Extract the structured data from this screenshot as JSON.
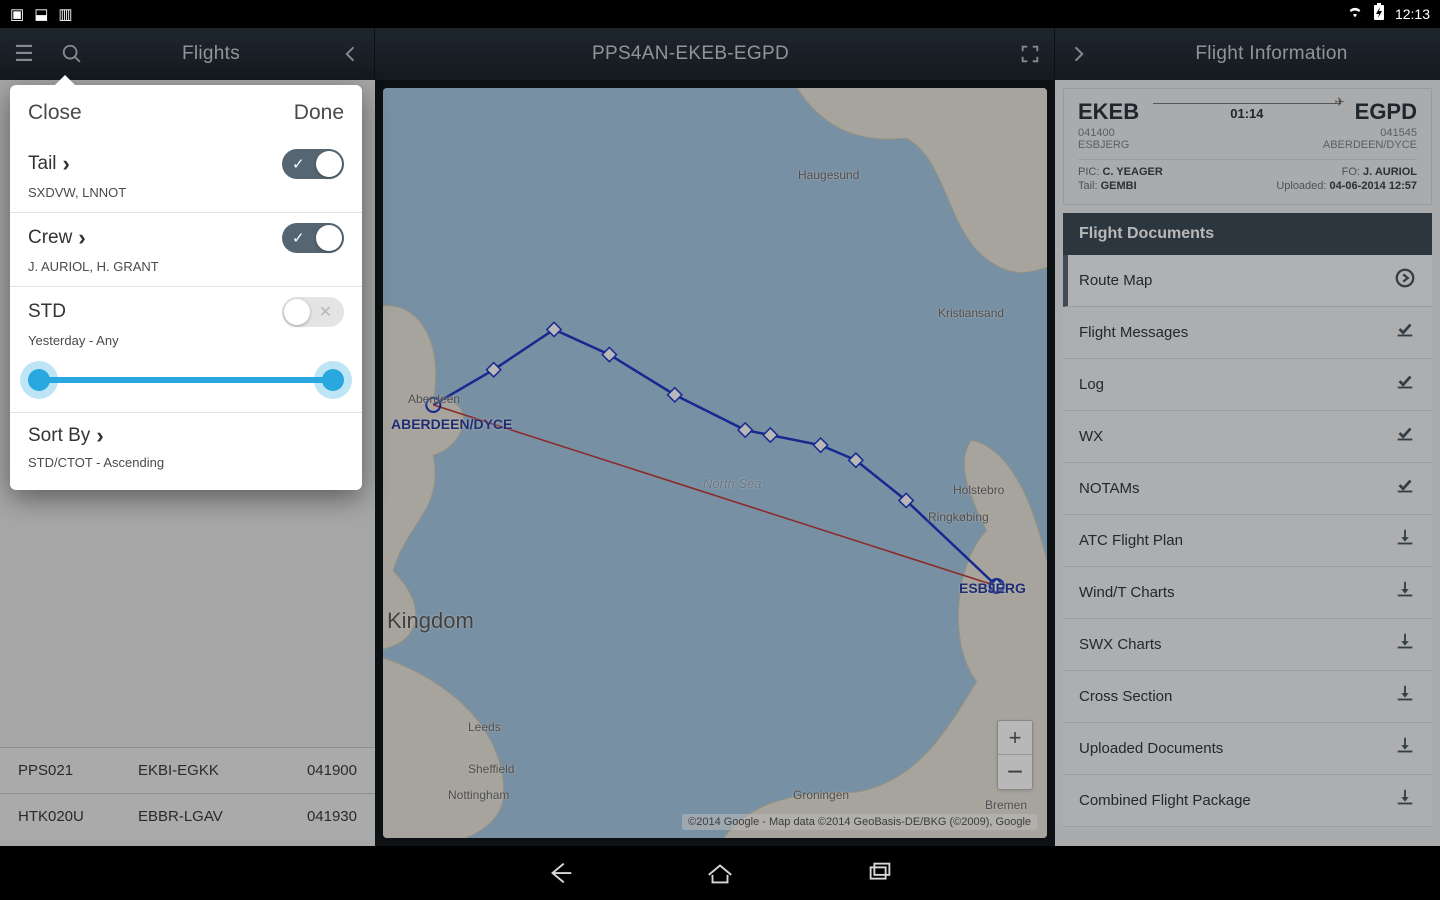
{
  "statusbar": {
    "time": "12:13"
  },
  "headers": {
    "left_title": "Flights",
    "center_title": "PPS4AN-EKEB-EGPD",
    "right_title": "Flight Information"
  },
  "popover": {
    "close": "Close",
    "done": "Done",
    "tail": {
      "label": "Tail",
      "sub": "SXDVW, LNNOT"
    },
    "crew": {
      "label": "Crew",
      "sub": "J. AURIOL, H. GRANT"
    },
    "std": {
      "label": "STD",
      "sub": "Yesterday - Any"
    },
    "sort": {
      "label": "Sort By",
      "sub": "STD/CTOT - Ascending"
    }
  },
  "flights_visible": [
    {
      "flight": "PPS021",
      "route": "EKBI-EGKK",
      "time": "041900"
    },
    {
      "flight": "HTK020U",
      "route": "EBBR-LGAV",
      "time": "041930"
    }
  ],
  "map": {
    "kingdom": "Kingdom",
    "north_sea": "North Sea",
    "ap_dep": "ESBJERG",
    "ap_arr": "ABERDEEN/DYCE",
    "cities": {
      "aberdeen": "Aberdeen",
      "haugesund": "Haugesund",
      "kristiansand": "Kristiansand",
      "holstebro": "Holstebro",
      "ringkobing": "Ringkøbing",
      "leeds": "Leeds",
      "sheffield": "Sheffield",
      "nottingham": "Nottingham",
      "groningen": "Groningen",
      "bremen": "Bremen"
    },
    "attr": "©2014 Google - Map data ©2014 GeoBasis-DE/BKG (©2009), Google"
  },
  "flight_info": {
    "dep": "EKEB",
    "arr": "EGPD",
    "dur": "01:14",
    "dep_time": "041400",
    "arr_time": "041545",
    "dep_name": "ESBJERG",
    "arr_name": "ABERDEEN/DYCE",
    "pic_lbl": "PIC:",
    "pic": "C. YEAGER",
    "fo_lbl": "FO:",
    "fo": "J. AURIOL",
    "tail_lbl": "Tail:",
    "tail": "GEMBI",
    "upl_lbl": "Uploaded:",
    "upl": "04-06-2014 12:57"
  },
  "docs": {
    "header": "Flight Documents",
    "items": [
      {
        "label": "Route Map",
        "icon": "go"
      },
      {
        "label": "Flight Messages",
        "icon": "check"
      },
      {
        "label": "Log",
        "icon": "check"
      },
      {
        "label": "WX",
        "icon": "check"
      },
      {
        "label": "NOTAMs",
        "icon": "check"
      },
      {
        "label": "ATC Flight Plan",
        "icon": "download"
      },
      {
        "label": "Wind/T Charts",
        "icon": "download"
      },
      {
        "label": "SWX Charts",
        "icon": "download"
      },
      {
        "label": "Cross Section",
        "icon": "download"
      },
      {
        "label": "Uploaded Documents",
        "icon": "download"
      },
      {
        "label": "Combined Flight Package",
        "icon": "download"
      }
    ]
  }
}
